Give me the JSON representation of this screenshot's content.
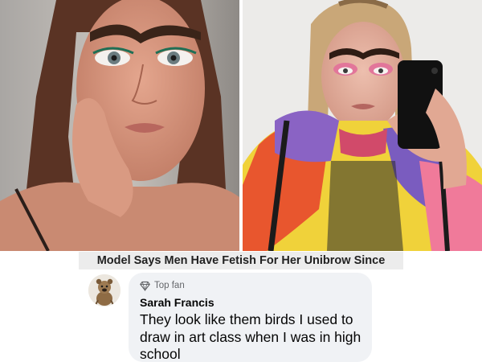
{
  "post": {
    "headline": "Model Says Men Have Fetish For Her Unibrow Since"
  },
  "comment": {
    "badge_icon": "diamond-icon",
    "badge_label": "Top fan",
    "author": "Sarah Francis",
    "text": "They look like them birds I used to draw in art class when I was in high school"
  },
  "colors": {
    "headline_bg": "#ececec",
    "bubble_bg": "#f0f2f5",
    "secondary_text": "#65676b",
    "primary_text": "#050505"
  }
}
